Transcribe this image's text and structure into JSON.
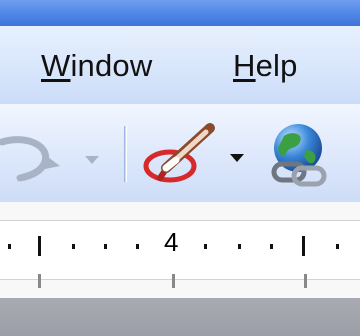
{
  "menubar": {
    "window": {
      "accel": "W",
      "rest": "indow"
    },
    "help": {
      "accel": "H",
      "rest": "elp"
    }
  },
  "toolbar": {
    "icons": {
      "undo": "undo-arrow-icon",
      "draw": "drawing-pen-icon",
      "hyperlink": "hyperlink-globe-icon"
    }
  },
  "ruler": {
    "label": "4"
  },
  "colors": {
    "title_blue": "#4f86e6",
    "menubar_bg": "#d7e5fb",
    "toolbar_bg": "#dfe9fc",
    "bottom_gray": "#9b9ea6"
  }
}
